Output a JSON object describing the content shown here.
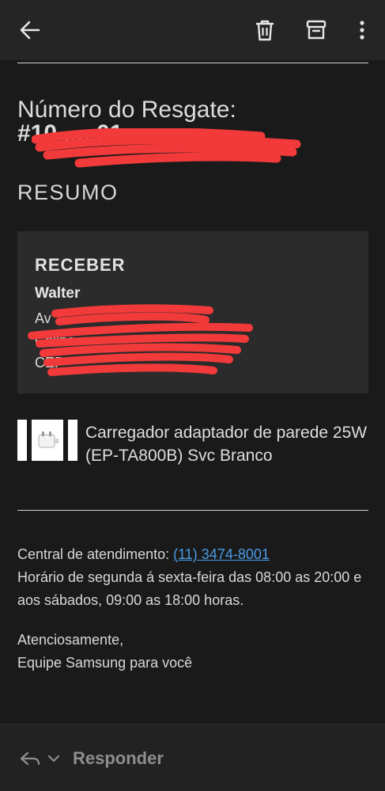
{
  "toolbar": {
    "back_icon": "arrow-left-icon",
    "delete_icon": "trash-icon",
    "archive_icon": "archive-icon",
    "more_icon": "more-vertical-icon"
  },
  "email": {
    "title_line1": "Número do Resgate:",
    "title_line2": "#10 .... 01",
    "section_heading": "RESUMO",
    "shipping": {
      "heading": "RECEBER",
      "name": "Walter",
      "line1": "Av",
      "line2": "Colina",
      "line3": "CEP"
    },
    "product": {
      "name": "Carregador adaptador de parede 25W (EP-TA800B) Svc Branco",
      "image_icon": "charger-icon"
    },
    "support_label": "Central de atendimento: ",
    "support_phone": "(11) 3474-8001",
    "hours": "Horário de segunda á sexta-feira das 08:00 as 20:00 e aos sábados, 09:00 as 18:00 horas.",
    "signoff": "Atenciosamente,",
    "team": "Equipe Samsung para você"
  },
  "bottom": {
    "reply_icon": "reply-icon",
    "chevron_icon": "chevron-down-icon",
    "reply_label": "Responder"
  },
  "colors": {
    "background": "#1a1a1a",
    "toolbar": "#252525",
    "card": "#2b2b2b",
    "link": "#4a9be8",
    "redaction": "#f23a3a"
  }
}
